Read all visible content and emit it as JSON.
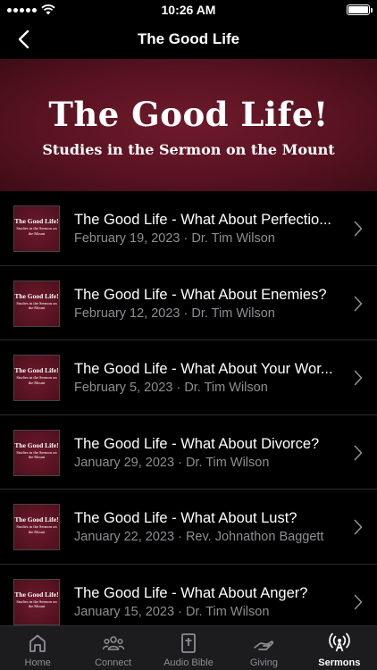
{
  "status_bar": {
    "time": "10:26 AM"
  },
  "nav": {
    "title": "The Good Life"
  },
  "banner": {
    "title": "The Good Life!",
    "subtitle": "Studies in the Sermon on the Mount"
  },
  "thumbnail": {
    "title": "The Good Life!",
    "subtitle": "Studies in the Sermon on the Mount"
  },
  "sermons": [
    {
      "title": "The Good Life - What About Perfectio...",
      "meta": "February 19, 2023 · Dr. Tim Wilson"
    },
    {
      "title": "The Good Life - What About Enemies?",
      "meta": "February 12, 2023 · Dr. Tim Wilson"
    },
    {
      "title": "The Good Life - What About Your Wor...",
      "meta": "February 5, 2023 · Dr. Tim Wilson"
    },
    {
      "title": "The Good Life - What About Divorce?",
      "meta": "January 29, 2023 · Dr. Tim Wilson"
    },
    {
      "title": "The Good Life - What About Lust?",
      "meta": "January 22, 2023 · Rev. Johnathon Baggett"
    },
    {
      "title": "The Good Life - What About Anger?",
      "meta": "January 15, 2023 · Dr. Tim Wilson"
    }
  ],
  "tabs": [
    {
      "label": "Home",
      "icon": "home-icon"
    },
    {
      "label": "Connect",
      "icon": "people-icon"
    },
    {
      "label": "Audio Bible",
      "icon": "bible-icon"
    },
    {
      "label": "Giving",
      "icon": "giving-hand-icon"
    },
    {
      "label": "Sermons",
      "icon": "broadcast-icon",
      "active": true
    }
  ],
  "colors": {
    "banner": "#5a1322",
    "tab_bar": "#1c1c1e",
    "secondary_text": "#8e8e93"
  }
}
